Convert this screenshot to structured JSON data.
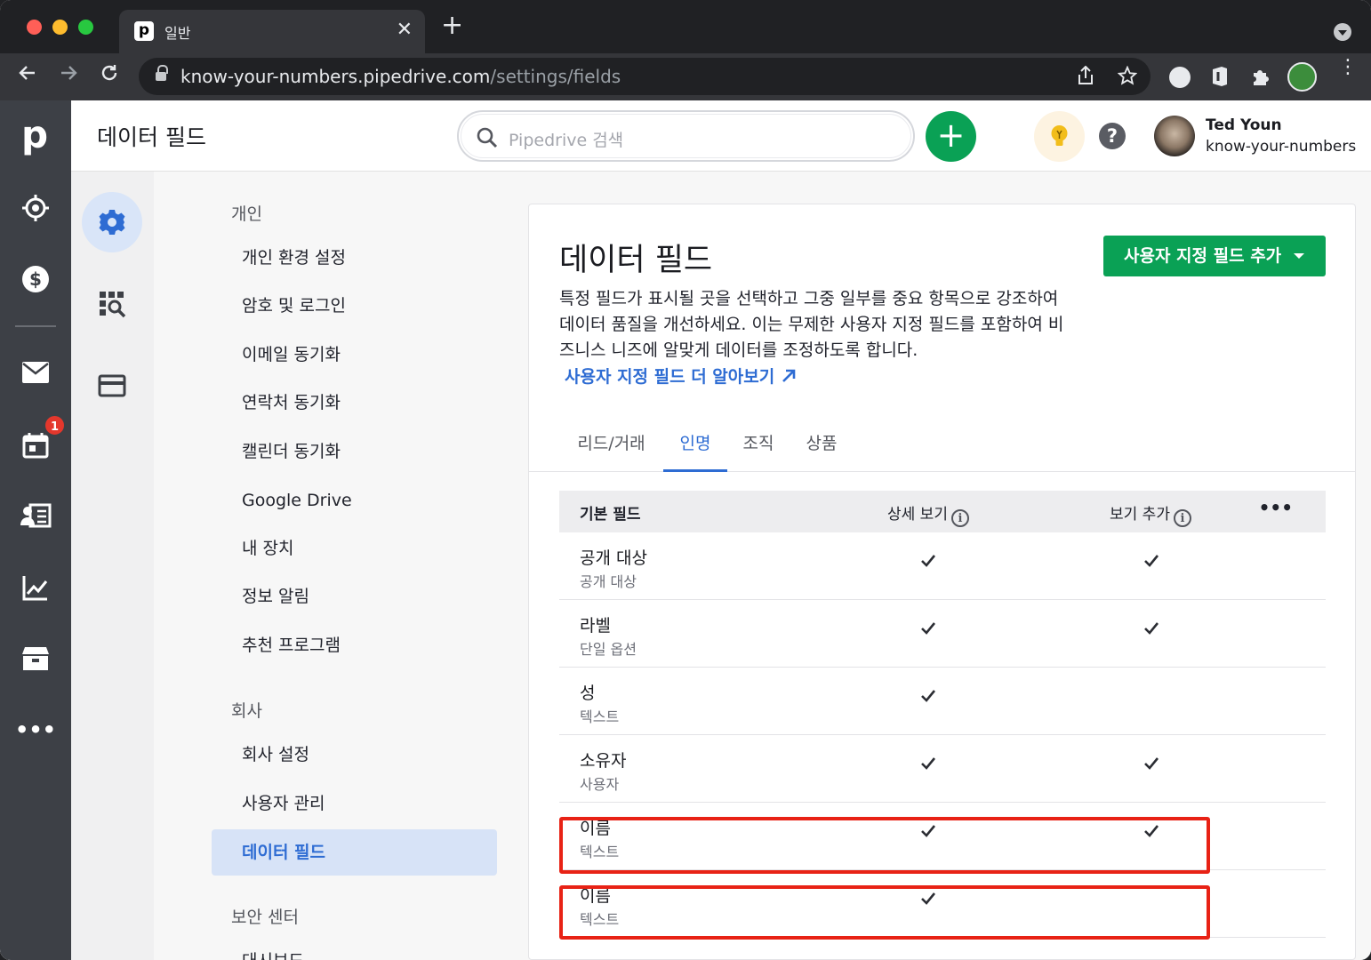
{
  "browser": {
    "tab_title": "일반",
    "tab_favicon": "p",
    "url_host": "know-your-numbers.pipedrive.com",
    "url_path": "/settings/fields"
  },
  "app": {
    "page_heading": "데이터 필드",
    "search_placeholder": "Pipedrive 검색",
    "user": {
      "name": "Ted Youn",
      "company": "know-your-numbers"
    },
    "rail": {
      "logo": "p",
      "calendar_badge": "1"
    }
  },
  "menu": {
    "groups": [
      {
        "title": "개인",
        "items": [
          "개인 환경 설정",
          "암호 및 로그인",
          "이메일 동기화",
          "연락처 동기화",
          "캘린더 동기화",
          "Google Drive",
          "내 장치",
          "정보 알림",
          "추천 프로그램"
        ]
      },
      {
        "title": "회사",
        "items": [
          "회사 설정",
          "사용자 관리",
          "데이터 필드"
        ]
      },
      {
        "title": "보안 센터",
        "items": [
          "대시보드"
        ]
      }
    ],
    "active_item": "데이터 필드"
  },
  "content": {
    "title": "데이터 필드",
    "add_button": "사용자 지정 필드 추가",
    "description": "특정 필드가 표시될 곳을 선택하고 그중 일부를 중요 항목으로 강조하여 데이터 품질을 개선하세요. 이는 무제한 사용자 지정 필드를 포함하여 비즈니스 니즈에 알맞게 데이터를 조정하도록 합니다.",
    "learn_more": "사용자 지정 필드 더 알아보기",
    "tabs": [
      "리드/거래",
      "인명",
      "조직",
      "상품"
    ],
    "active_tab": "인명",
    "table": {
      "columns": [
        "기본 필드",
        "상세 보기",
        "보기 추가"
      ],
      "rows": [
        {
          "name": "공개 대상",
          "type": "공개 대상",
          "detail": true,
          "add": true
        },
        {
          "name": "라벨",
          "type": "단일 옵션",
          "detail": true,
          "add": true
        },
        {
          "name": "성",
          "type": "텍스트",
          "detail": true,
          "add": false
        },
        {
          "name": "소유자",
          "type": "사용자",
          "detail": true,
          "add": true
        },
        {
          "name": "이름",
          "type": "텍스트",
          "detail": true,
          "add": true
        },
        {
          "name": "이름",
          "type": "텍스트",
          "detail": true,
          "add": false
        }
      ]
    }
  },
  "colors": {
    "accent_blue": "#2e6cd3",
    "primary_green": "#0aa155",
    "rail_bg": "#3d4046",
    "highlight_red": "#e82215"
  }
}
